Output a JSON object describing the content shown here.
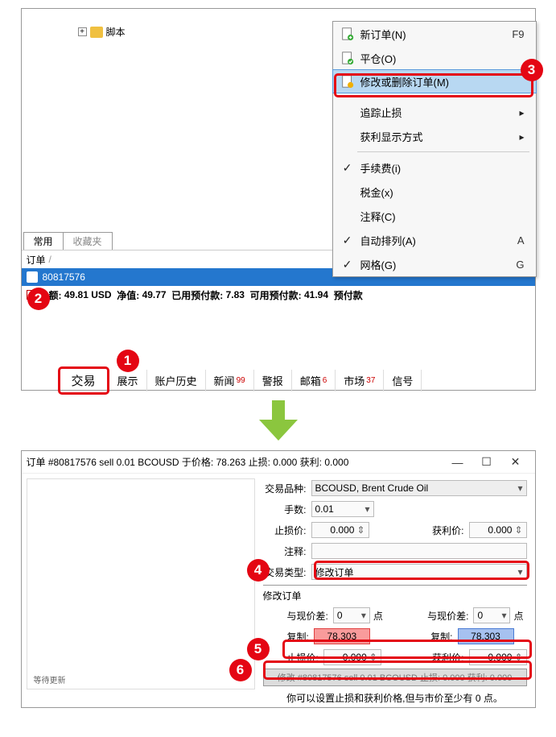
{
  "tree": {
    "script_label": "脚本"
  },
  "nav_tabs": {
    "common": "常用",
    "favorites": "收藏夹"
  },
  "orders": {
    "header": "订单",
    "order_id": "80817576",
    "balance_label": "余额:",
    "balance_value": "49.81 USD",
    "equity_label": "净值:",
    "equity_value": "49.77",
    "margin_label": "已用预付款:",
    "margin_value": "7.83",
    "free_margin_label": "可用预付款:",
    "free_margin_value": "41.94",
    "extra_label": "预付款"
  },
  "bottom_tabs": {
    "trade": "交易",
    "display": "展示",
    "history": "账户历史",
    "news": "新闻",
    "news_count": "99",
    "alert": "警报",
    "mail": "邮箱",
    "mail_count": "6",
    "market": "市场",
    "market_count": "37",
    "signals": "信号"
  },
  "context_menu": {
    "new_order": "新订单(N)",
    "new_order_key": "F9",
    "close": "平仓(O)",
    "modify": "修改或删除订单(M)",
    "trailing": "追踪止损",
    "profit_mode": "获利显示方式",
    "commission": "手续费(i)",
    "tax": "税金(x)",
    "comment": "注释(C)",
    "auto_arrange": "自动排列(A)",
    "auto_arrange_key": "A",
    "grid": "网格(G)",
    "grid_key": "G"
  },
  "badges": {
    "b1": "1",
    "b2": "2",
    "b3": "3",
    "b4": "4",
    "b5": "5",
    "b6": "6"
  },
  "dialog": {
    "title": "订单 #80817576 sell 0.01 BCOUSD 于价格: 78.263 止损: 0.000 获利: 0.000",
    "symbol_label": "交易品种:",
    "symbol_value": "BCOUSD, Brent Crude Oil",
    "volume_label": "手数:",
    "volume_value": "0.01",
    "sl_label": "止损价:",
    "sl_value": "0.000",
    "tp_label": "获利价:",
    "tp_value": "0.000",
    "comment_label": "注释:",
    "type_label": "交易类型:",
    "type_value": "修改订单",
    "modify_section": "修改订单",
    "diff_label": "与现价差:",
    "diff_value": "0",
    "diff_unit": "点",
    "copy_label": "复制:",
    "copy_red": "78.303",
    "copy_blue": "78.303",
    "sl2_value": "0.000",
    "tp2_value": "0.000",
    "modify_btn": "修改 #80817576 sell 0.01 BCOUSD 止损: 0.000 获利: 0.000",
    "footer": "你可以设置止损和获利价格,但与市价至少有 0 点。",
    "thumb_footer": "等待更新"
  }
}
